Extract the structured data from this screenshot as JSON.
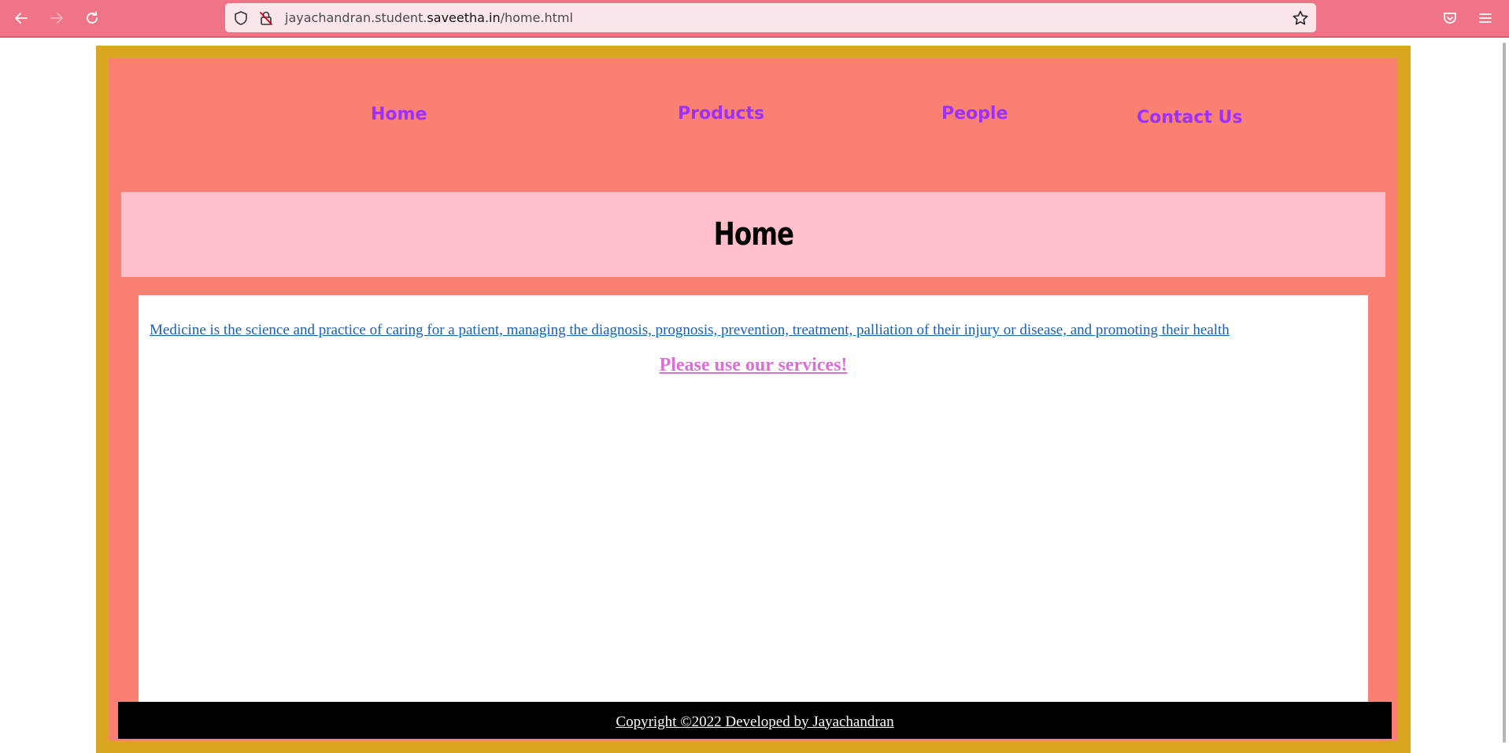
{
  "browser": {
    "url_prefix": "jayachandran.student.",
    "url_domain": "saveetha.in",
    "url_path": "/home.html",
    "icons": [
      "back-arrow-icon",
      "forward-arrow-icon",
      "reload-icon",
      "shield-icon",
      "insecure-lock-icon",
      "star-icon",
      "pocket-icon",
      "menu-icon"
    ]
  },
  "nav": {
    "home": "Home",
    "products": "Products",
    "people": "People",
    "contact": "Contact Us"
  },
  "banner": {
    "title": "Home"
  },
  "content": {
    "paragraph": "Medicine is the science and practice of caring for a patient, managing the diagnosis, prognosis, prevention, treatment, palliation of their injury or disease, and promoting their health",
    "cta": "Please use our services!"
  },
  "footer": {
    "copyright": "Copyright ©2022 Developed by Jayachandran"
  },
  "colors": {
    "toolbar": "#f07487",
    "border_gold": "#daa520",
    "salmon": "#fa8072",
    "banner_pink": "#ffc0cb",
    "nav_purple": "#9b30ff",
    "link_blue": "#1a5fb4",
    "cta_orchid": "#da70d6"
  }
}
